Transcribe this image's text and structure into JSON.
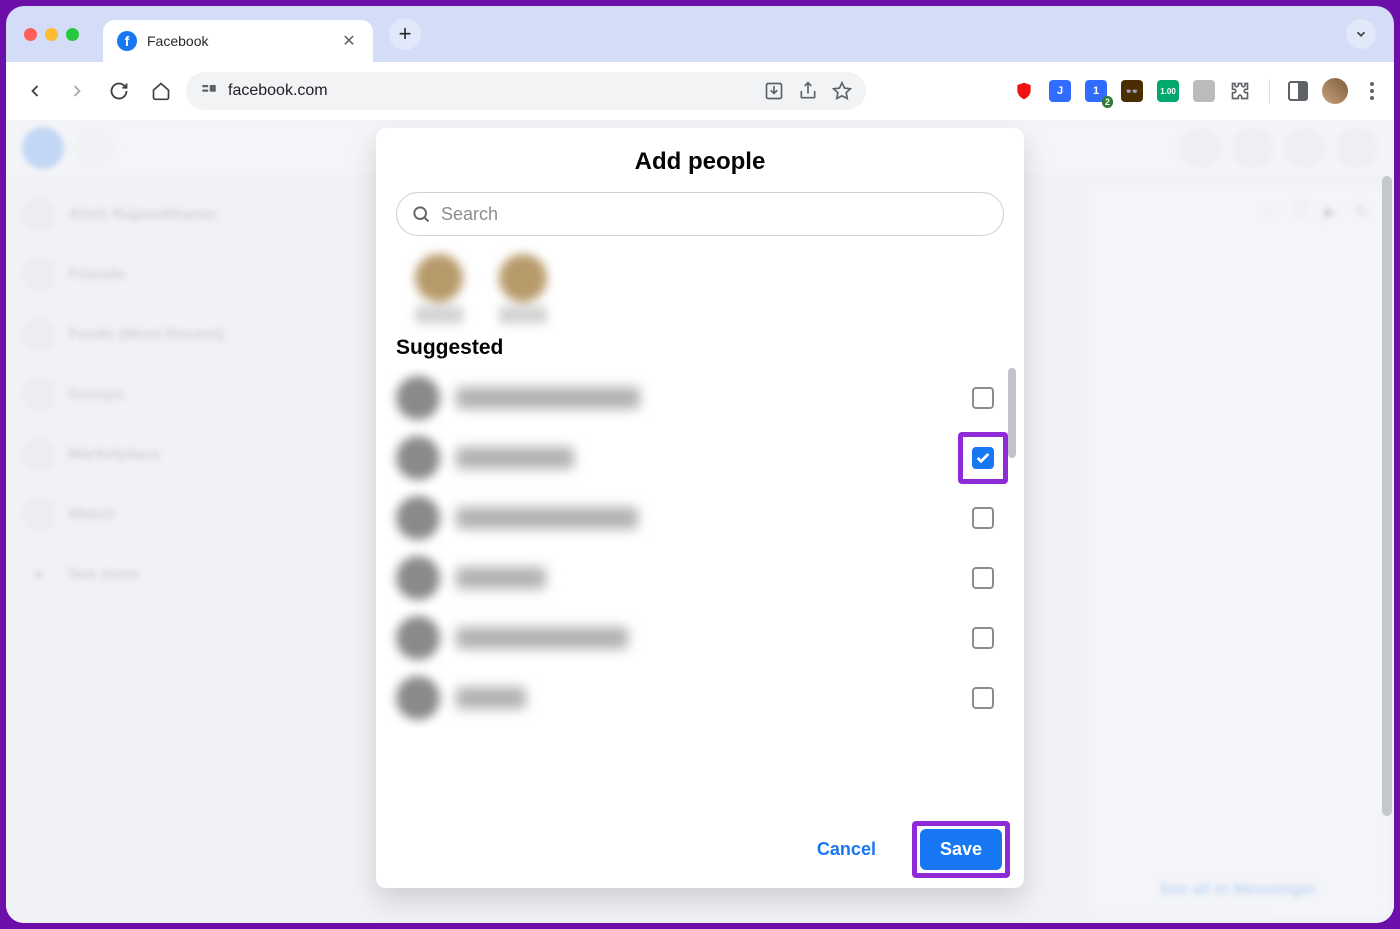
{
  "browser": {
    "tab_title": "Facebook",
    "address": "facebook.com"
  },
  "sidebar": {
    "items": [
      {
        "label": "Atish Rajasekharan"
      },
      {
        "label": "Friends"
      },
      {
        "label": "Feeds (Most Recent)"
      },
      {
        "label": "Groups"
      },
      {
        "label": "Marketplace"
      },
      {
        "label": "Watch"
      },
      {
        "label": "See more"
      }
    ]
  },
  "right_rail": {
    "footer_link": "See all in Messenger"
  },
  "modal": {
    "title": "Add people",
    "search_placeholder": "Search",
    "section_title": "Suggested",
    "cancel_label": "Cancel",
    "save_label": "Save",
    "suggested": [
      {
        "checked": false,
        "name_width": 184
      },
      {
        "checked": true,
        "name_width": 118
      },
      {
        "checked": false,
        "name_width": 182
      },
      {
        "checked": false,
        "name_width": 90
      },
      {
        "checked": false,
        "name_width": 172
      },
      {
        "checked": false,
        "name_width": 70
      }
    ]
  },
  "colors": {
    "accent": "#1877f2",
    "highlight": "#8e2bd6"
  }
}
